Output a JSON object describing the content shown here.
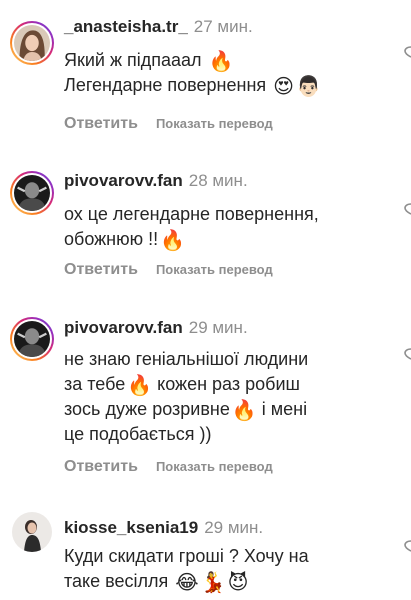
{
  "comments": [
    {
      "username": "_anasteisha.tr_",
      "time": "27 мин.",
      "line1": "Який ж підпааал",
      "line2": "Легендарне повернення",
      "emoji1": [
        "fire-emoji"
      ],
      "emoji2": [
        "heart-eyes-emoji",
        "man-emoji"
      ],
      "reply": "Ответить",
      "translate": "Показать перевод"
    },
    {
      "username": "pivovarovv.fan",
      "time": "28 мин.",
      "line1": "ох це легендарне повернення,",
      "line2": "обожнюю !!",
      "emoji2": [
        "fire-emoji"
      ],
      "reply": "Ответить",
      "translate": "Показать перевод"
    },
    {
      "username": "pivovarovv.fan",
      "time": "29 мин.",
      "line1": "не знаю геніальнішої людини",
      "line2": "за тебе",
      "line2b": "кожен раз робиш",
      "line3": "зось дуже розривне",
      "line3b": "і мені",
      "line4": "це подобається ))",
      "reply": "Ответить",
      "translate": "Показать перевод"
    },
    {
      "username": "kiosse_ksenia19",
      "time": "29 мин.",
      "line1": "Куди скидати гроші ? Хочу на",
      "line2": "таке весілля",
      "emoji2": [
        "tears-of-joy-emoji",
        "dancer-emoji",
        "devil-emoji"
      ]
    }
  ],
  "emoji_glyphs": {
    "fire": "🔥",
    "heart_eyes": "😍",
    "man": "👨🏻",
    "tears_of_joy": "😂",
    "dancer": "💃",
    "devil": "😈"
  }
}
